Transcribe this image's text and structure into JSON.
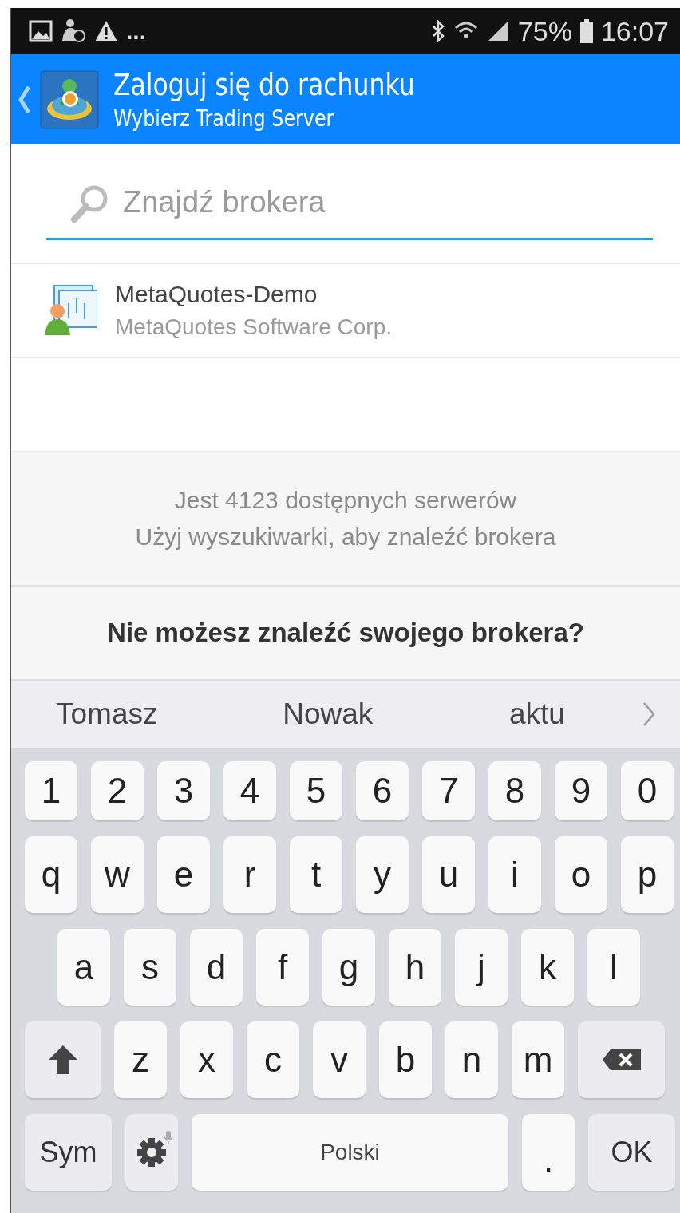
{
  "status_bar": {
    "more": "...",
    "battery": "75%",
    "time": "16:07"
  },
  "header": {
    "title": "Zaloguj się do rachunku",
    "subtitle": "Wybierz Trading Server"
  },
  "search": {
    "placeholder": "Znajdź brokera"
  },
  "servers": [
    {
      "name": "MetaQuotes-Demo",
      "company": "MetaQuotes Software Corp."
    }
  ],
  "info": {
    "line_1": "Jest 4123 dostępnych serwerów",
    "line_2": "Użyj wyszukiwarki, aby znaleźć brokera"
  },
  "help_link": "Nie możesz znaleźć swojego brokera?",
  "suggestions": [
    "Tomasz",
    "Nowak",
    "aktu"
  ],
  "keyboard": [
    [
      {
        "kind": "char",
        "label": "1"
      },
      {
        "kind": "char",
        "label": "2"
      },
      {
        "kind": "char",
        "label": "3"
      },
      {
        "kind": "char",
        "label": "4"
      },
      {
        "kind": "char",
        "label": "5"
      },
      {
        "kind": "char",
        "label": "6"
      },
      {
        "kind": "char",
        "label": "7"
      },
      {
        "kind": "char",
        "label": "8"
      },
      {
        "kind": "char",
        "label": "9"
      },
      {
        "kind": "char",
        "label": "0"
      }
    ],
    [
      {
        "kind": "char",
        "label": "q"
      },
      {
        "kind": "char",
        "label": "w"
      },
      {
        "kind": "char",
        "label": "e"
      },
      {
        "kind": "char",
        "label": "r"
      },
      {
        "kind": "char",
        "label": "t"
      },
      {
        "kind": "char",
        "label": "y"
      },
      {
        "kind": "char",
        "label": "u"
      },
      {
        "kind": "char",
        "label": "i"
      },
      {
        "kind": "char",
        "label": "o"
      },
      {
        "kind": "char",
        "label": "p"
      }
    ],
    [
      {
        "kind": "char",
        "label": "a"
      },
      {
        "kind": "char",
        "label": "s"
      },
      {
        "kind": "char",
        "label": "d"
      },
      {
        "kind": "char",
        "label": "f"
      },
      {
        "kind": "char",
        "label": "g"
      },
      {
        "kind": "char",
        "label": "h"
      },
      {
        "kind": "char",
        "label": "j"
      },
      {
        "kind": "char",
        "label": "k"
      },
      {
        "kind": "char",
        "label": "l"
      }
    ],
    [
      {
        "kind": "shift"
      },
      {
        "kind": "char",
        "label": "z"
      },
      {
        "kind": "char",
        "label": "x"
      },
      {
        "kind": "char",
        "label": "c"
      },
      {
        "kind": "char",
        "label": "v"
      },
      {
        "kind": "char",
        "label": "b"
      },
      {
        "kind": "char",
        "label": "n"
      },
      {
        "kind": "char",
        "label": "m"
      },
      {
        "kind": "backspace"
      }
    ],
    [
      {
        "kind": "function",
        "label": "Sym"
      },
      {
        "kind": "settings"
      },
      {
        "kind": "space",
        "label": "Polski"
      },
      {
        "kind": "dot",
        "label": "."
      },
      {
        "kind": "function",
        "label": "OK"
      }
    ]
  ]
}
